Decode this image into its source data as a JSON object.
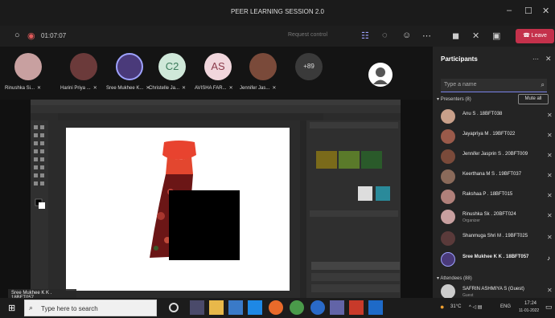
{
  "window": {
    "title": "PEER LEARNING SESSION 2.0",
    "controls": [
      "–",
      "☐",
      "✕"
    ]
  },
  "toolbar": {
    "timer": "01:07:07",
    "request_control": "Request control",
    "leave": "Leave"
  },
  "strip": {
    "tiles": [
      {
        "name": "Rinushka Si...",
        "initials": "",
        "color": "#c8a0a0"
      },
      {
        "name": "Harini Priya ...",
        "initials": "",
        "color": "#6b3a3a"
      },
      {
        "name": "Sree Mukhee K...",
        "initials": "",
        "color": "#4a3a7a"
      },
      {
        "name": "Christelle Ja...",
        "initials": "C2",
        "color": "#cfe8d9"
      },
      {
        "name": "AVISHA FAR...",
        "initials": "AS",
        "color": "#f1d6dc"
      },
      {
        "name": "Jennifer Jas...",
        "initials": "",
        "color": "#7a4a3a"
      },
      {
        "name": "",
        "initials": "+89",
        "color": "#3a3a3a"
      }
    ]
  },
  "sidebar": {
    "title": "Participants",
    "search_placeholder": "Type a name",
    "presenters_label": "Presenters (8)",
    "mute_all": "Mute all",
    "attendees_label": "Attendees (88)",
    "presenters": [
      {
        "name": "Anu S . 18BFT038",
        "sub": ""
      },
      {
        "name": "Jayapriya M . 19BFT022",
        "sub": ""
      },
      {
        "name": "Jennifer Jasprin S . 20BFT009",
        "sub": ""
      },
      {
        "name": "Keerthana M S . 19BFT037",
        "sub": ""
      },
      {
        "name": "Rakshaa P . 18BFT015",
        "sub": ""
      },
      {
        "name": "Rinushka Sk . 20BFT024",
        "sub": "Organizer"
      },
      {
        "name": "Shanmuga Shri M . 19BFT025",
        "sub": ""
      },
      {
        "name": "Sree Mukhee K K . 18BFT057",
        "sub": ""
      }
    ],
    "attendees": [
      {
        "name": "SAFRIN ASHMIYA S (Guest)",
        "sub": "Guest"
      }
    ]
  },
  "caption": "Sree Mukhee K K . 18BFT057",
  "taskbar": {
    "search_placeholder": "Type here to search",
    "weather": "31°C",
    "lang": "ENG",
    "time": "17:24",
    "date": "11-01-2022"
  }
}
